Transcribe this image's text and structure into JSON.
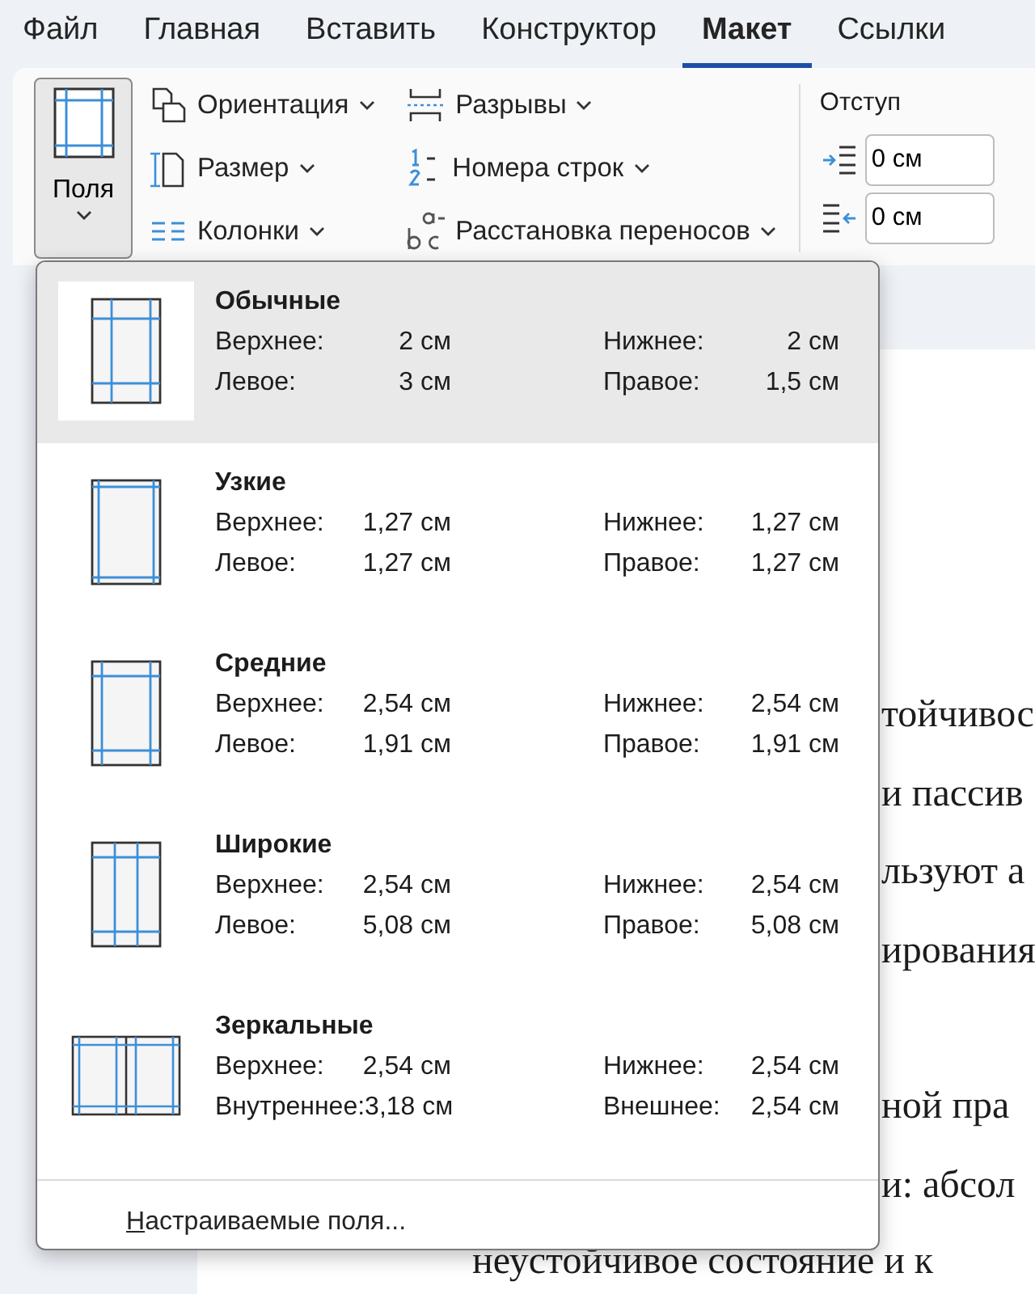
{
  "tabs": [
    {
      "label": "Файл",
      "selected": false
    },
    {
      "label": "Главная",
      "selected": false
    },
    {
      "label": "Вставить",
      "selected": false
    },
    {
      "label": "Конструктор",
      "selected": false
    },
    {
      "label": "Макет",
      "selected": true
    },
    {
      "label": "Ссылки",
      "selected": false
    }
  ],
  "ribbon": {
    "margins_button": {
      "label": "Поля",
      "pressed": true
    },
    "columns": [
      [
        {
          "label": "Ориентация"
        },
        {
          "label": "Размер"
        },
        {
          "label": "Колонки"
        }
      ],
      [
        {
          "label": "Разрывы"
        },
        {
          "label": "Номера строк"
        },
        {
          "label": "Расстановка переносов"
        }
      ]
    ],
    "indent": {
      "title": "Отступ",
      "fields": [
        {
          "value": "0 см"
        },
        {
          "value": "0 см"
        }
      ]
    }
  },
  "margins_menu": {
    "presets": [
      {
        "name": "Обычные",
        "kind": "normal",
        "selected": true,
        "values": [
          [
            "Верхнее:",
            "2 см",
            "Нижнее:",
            "2 см"
          ],
          [
            "Левое:",
            "3 см",
            "Правое:",
            "1,5 см"
          ]
        ]
      },
      {
        "name": "Узкие",
        "kind": "narrow",
        "selected": false,
        "values": [
          [
            "Верхнее:",
            "1,27 см",
            "Нижнее:",
            "1,27 см"
          ],
          [
            "Левое:",
            "1,27 см",
            "Правое:",
            "1,27 см"
          ]
        ]
      },
      {
        "name": "Средние",
        "kind": "moderate",
        "selected": false,
        "values": [
          [
            "Верхнее:",
            "2,54 см",
            "Нижнее:",
            "2,54 см"
          ],
          [
            "Левое:",
            "1,91 см",
            "Правое:",
            "1,91 см"
          ]
        ]
      },
      {
        "name": "Широкие",
        "kind": "wide",
        "selected": false,
        "values": [
          [
            "Верхнее:",
            "2,54 см",
            "Нижнее:",
            "2,54 см"
          ],
          [
            "Левое:",
            "5,08 см",
            "Правое:",
            "5,08 см"
          ]
        ]
      },
      {
        "name": "Зеркальные",
        "kind": "mirrored",
        "selected": false,
        "values": [
          [
            "Верхнее:",
            "2,54 см",
            "Нижнее:",
            "2,54 см"
          ],
          [
            "Внутреннее:",
            "3,18 см",
            "Внешнее:",
            "2,54 см"
          ]
        ]
      }
    ],
    "custom": "Настраиваемые поля..."
  },
  "document": {
    "paragraphs": [
      [
        "тойчивос",
        "и пассив",
        "льзуют а",
        "ирования"
      ],
      [
        "ной пра",
        "и: абсол"
      ]
    ],
    "last_line": "неустойчивое состояние и к"
  }
}
